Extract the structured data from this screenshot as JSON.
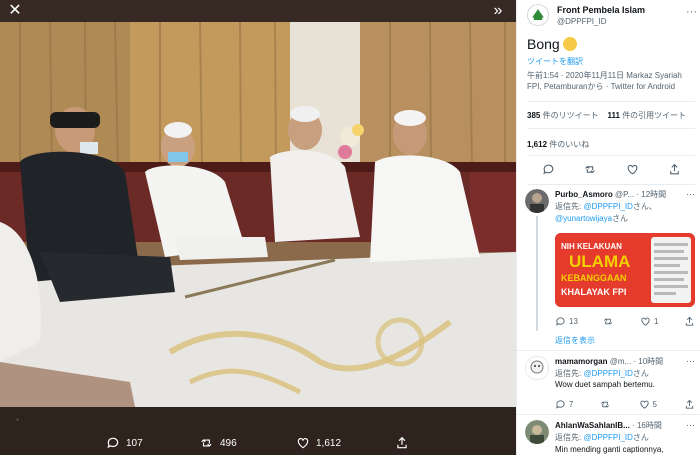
{
  "viewer": {
    "close_icon": "close-icon",
    "expand_icon": "double-chevron-right-icon",
    "actions": {
      "reply_count": "107",
      "retweet_count": "496",
      "like_count": "1,612"
    }
  },
  "tweet": {
    "author_name": "Front Pembela Islam",
    "author_handle": "@DPPFPI_ID",
    "text": "Bong",
    "translate": "ツイートを翻訳",
    "meta": "午前1:54 · 2020年11月11日 Markaz Syariah FPI, Petamburanから · Twitter for Android",
    "retweets_count": "385",
    "retweets_label": "件のリツイート",
    "quotes_count": "111",
    "quotes_label": "件の引用ツイート",
    "likes_count": "1,612",
    "likes_label": "件のいいね"
  },
  "replies": [
    {
      "name": "Purbo_Asmoro",
      "handle": "@P...",
      "time": "· 12時間",
      "reply_to_prefix": "返信先: ",
      "reply_to_1": "@DPPFPI_ID",
      "reply_to_suffix": "さん、",
      "reply_to_2": "@yunartowijaya",
      "reply_to_2_suffix": "さん",
      "image_lines": [
        "NIH KELAKUAN",
        "ULAMA",
        "KEBANGGAAN",
        "KHALAYAK FPI"
      ],
      "reply_count": "13",
      "like_count": "1",
      "show_replies": "返信を表示"
    },
    {
      "name": "mamamorgan",
      "handle": "@m...",
      "time": "· 10時間",
      "reply_to_prefix": "返信先: ",
      "reply_to_1": "@DPPFPI_ID",
      "reply_to_suffix": "さん",
      "text": "Wow duet sampah bertemu.",
      "reply_count": "7",
      "like_count": "5"
    },
    {
      "name": "AhlanWaSahlanIB...",
      "handle": "",
      "time": "· 16時間",
      "reply_to_prefix": "返信先: ",
      "reply_to_1": "@DPPFPI_ID",
      "reply_to_suffix": "さん",
      "text": "Min mending ganti captionnya,"
    }
  ],
  "colors": {
    "link": "#1d9bf0",
    "secondary": "#536471",
    "viewer_bg": "#4a3b33"
  }
}
